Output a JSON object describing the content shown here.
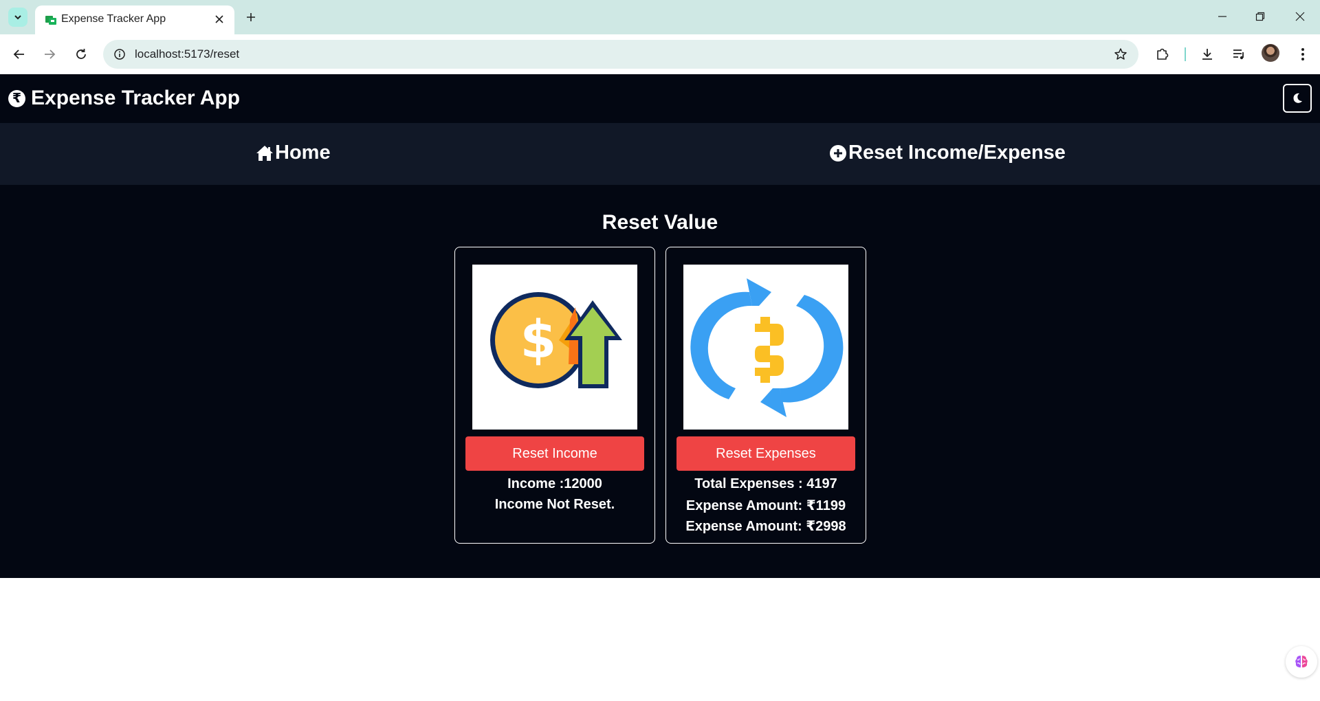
{
  "browser": {
    "tab_title": "Expense Tracker App",
    "url": "localhost:5173/reset"
  },
  "app": {
    "title": "Expense Tracker App",
    "nav": [
      {
        "label": "Home",
        "icon": "home-icon"
      },
      {
        "label": "Reset Income/Expense",
        "icon": "plus-circle-icon"
      }
    ],
    "section_title": "Reset Value",
    "income_card": {
      "image": "income-up-arrow-coin-illustration",
      "button_label": "Reset Income",
      "income_text": "Income :12000",
      "status_text": "Income Not Reset."
    },
    "expense_card": {
      "image": "refresh-currency-illustration",
      "button_label": "Reset Expenses",
      "total_text": "Total Expenses : 4197",
      "expense_items": [
        "Expense Amount: ₹1199",
        "Expense Amount: ₹2998"
      ]
    }
  },
  "colors": {
    "app_bg": "#030712",
    "nav_bg": "#111827",
    "button_red": "#ef4444",
    "browser_tabbar": "#cfe8e4"
  }
}
